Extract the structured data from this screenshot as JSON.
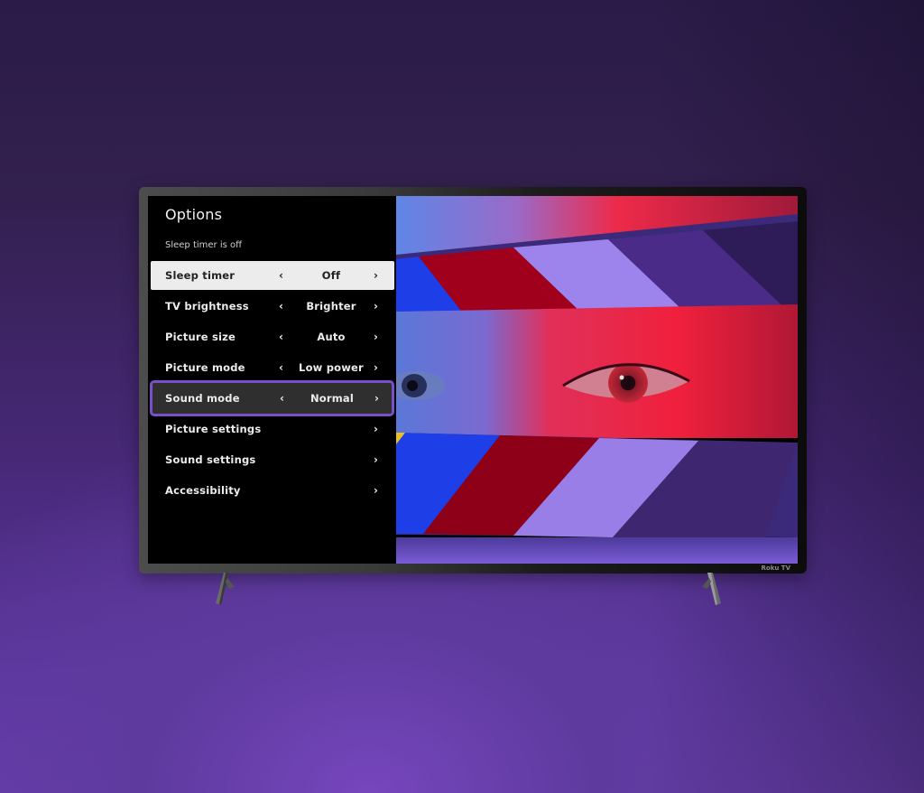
{
  "tv": {
    "brand": "Roku TV"
  },
  "menu": {
    "title": "Options",
    "subtitle": "Sleep timer is off",
    "items": [
      {
        "label": "Sleep timer",
        "value": "Off",
        "has_arrows": true,
        "state": "selected"
      },
      {
        "label": "TV brightness",
        "value": "Brighter",
        "has_arrows": true,
        "state": "normal"
      },
      {
        "label": "Picture size",
        "value": "Auto",
        "has_arrows": true,
        "state": "normal"
      },
      {
        "label": "Picture mode",
        "value": "Low power",
        "has_arrows": true,
        "state": "normal"
      },
      {
        "label": "Sound mode",
        "value": "Normal",
        "has_arrows": true,
        "state": "focused"
      },
      {
        "label": "Picture settings",
        "value": "",
        "has_arrows": false,
        "state": "normal"
      },
      {
        "label": "Sound settings",
        "value": "",
        "has_arrows": false,
        "state": "normal"
      },
      {
        "label": "Accessibility",
        "value": "",
        "has_arrows": false,
        "state": "normal"
      }
    ],
    "arrow_left": "‹",
    "arrow_right": "›"
  },
  "colors": {
    "focus_outline": "#7b4fc9",
    "selected_bg": "#ececec",
    "background_top": "#2a1b48",
    "background_bottom": "#7646bd"
  }
}
